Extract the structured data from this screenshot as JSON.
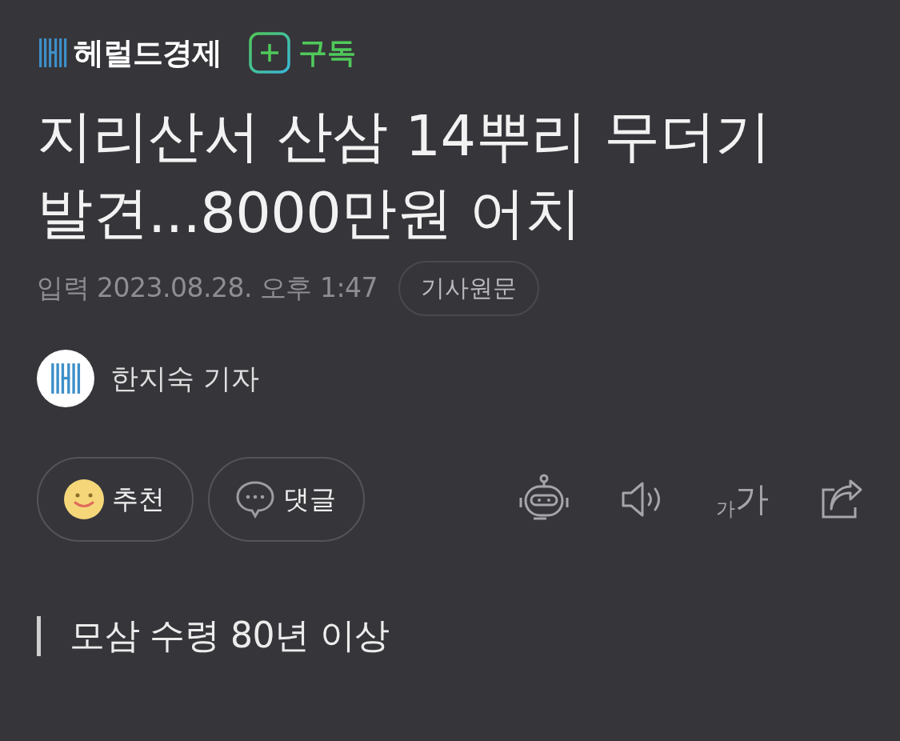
{
  "press": {
    "name": "헤럴드경제",
    "subscribe": "구독"
  },
  "headline": "지리산서 산삼 14뿌리 무더기 발견...8000만원 어치",
  "meta": {
    "timestamp": "입력 2023.08.28. 오후 1:47",
    "original_link": "기사원문"
  },
  "reporter": {
    "name": "한지숙 기자"
  },
  "actions": [
    {
      "kind": "smile",
      "label": "추천"
    },
    {
      "kind": "comment",
      "label": "댓글"
    }
  ],
  "tools": {
    "font_size": [
      "가",
      "가"
    ]
  },
  "subheading": "모삼 수령 80년 이상"
}
